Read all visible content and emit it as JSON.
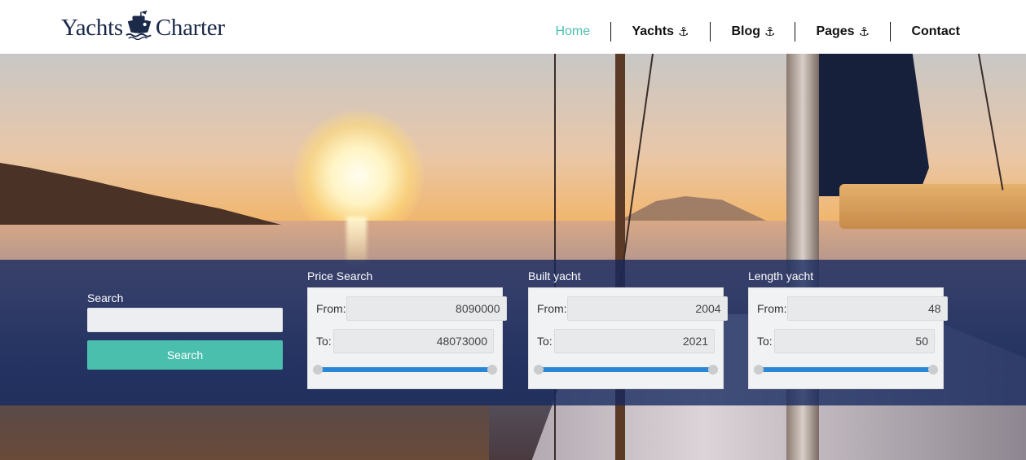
{
  "header": {
    "logo": {
      "left_text": "Yachts",
      "right_text": "Charter",
      "icon": "ship-icon"
    },
    "nav": [
      {
        "label": "Home",
        "active": true,
        "icon": null
      },
      {
        "label": "Yachts",
        "active": false,
        "icon": "anchor-icon",
        "glyph": "⚓"
      },
      {
        "label": "Blog",
        "active": false,
        "icon": "anchor-icon",
        "glyph": "⚓"
      },
      {
        "label": "Pages",
        "active": false,
        "icon": "anchor-icon",
        "glyph": "⚓"
      },
      {
        "label": "Contact",
        "active": false,
        "icon": null
      }
    ]
  },
  "search": {
    "label": "Search",
    "input_value": "",
    "input_placeholder": "",
    "button_label": "Search"
  },
  "filters": [
    {
      "title": "Price Search",
      "from_label": "From:",
      "to_label": "To:",
      "from_value": "8090000",
      "to_value": "48073000",
      "range_min_fraction": 0,
      "range_max_fraction": 1
    },
    {
      "title": "Built yacht",
      "from_label": "From:",
      "to_label": "To:",
      "from_value": "2004",
      "to_value": "2021",
      "range_min_fraction": 0,
      "range_max_fraction": 1
    },
    {
      "title": "Length yacht",
      "from_label": "From:",
      "to_label": "To:",
      "from_value": "48",
      "to_value": "50",
      "range_min_fraction": 0,
      "range_max_fraction": 1
    }
  ],
  "colors": {
    "accent": "#4bbfae",
    "active_nav": "#4dbfb0",
    "slider_track": "#2a87d6",
    "panel_overlay": "#14285f",
    "logo_text": "#1c2a4a"
  }
}
